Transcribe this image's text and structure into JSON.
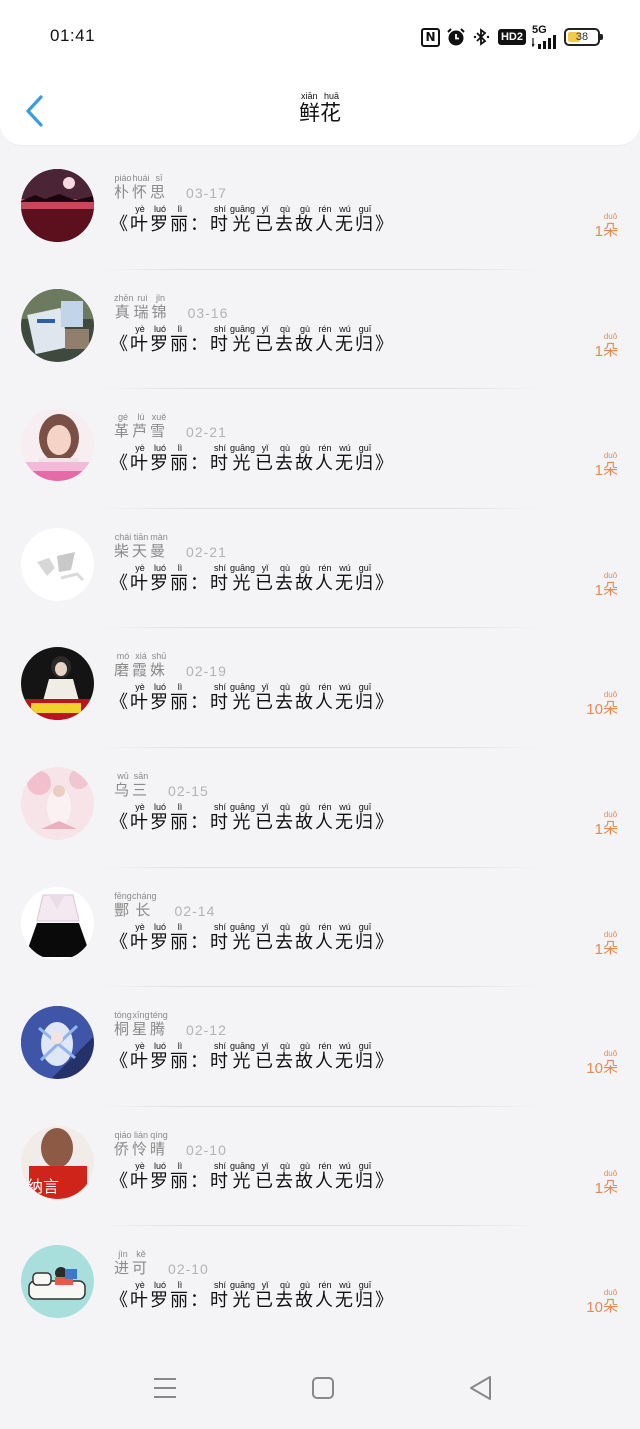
{
  "status": {
    "time": "01:41",
    "battery": "38",
    "network": "5G",
    "hd": "HD2",
    "nfc": "N"
  },
  "header": {
    "title": "鲜花",
    "title_pinyin": "xiān huā"
  },
  "records": [
    {
      "name": "朴怀思",
      "name_pinyin": "piáo huái sī",
      "date": "03-17",
      "work": "《叶罗丽：时光已去故人无归》",
      "count": "1",
      "avatar": "avatar-night-lake"
    },
    {
      "name": "真瑞锦",
      "name_pinyin": "zhēn ruì jǐn",
      "date": "03-16",
      "work": "《叶罗丽：时光已去故人无归》",
      "count": "1",
      "avatar": "avatar-poster-reader"
    },
    {
      "name": "革芦雪",
      "name_pinyin": "gé lú xuě",
      "date": "02-21",
      "work": "《叶罗丽：时光已去故人无归》",
      "count": "1",
      "avatar": "avatar-girl-caption"
    },
    {
      "name": "柴天曼",
      "name_pinyin": "chái tiān màn",
      "date": "02-21",
      "work": "《叶罗丽：时光已去故人无归》",
      "count": "1",
      "avatar": "avatar-blank-sketch"
    },
    {
      "name": "磨霞姝",
      "name_pinyin": "mó xiá shū",
      "date": "02-19",
      "work": "《叶罗丽：时光已去故人无归》",
      "count": "10",
      "avatar": "avatar-dark-girl"
    },
    {
      "name": "乌三",
      "name_pinyin": "wū sān",
      "date": "02-15",
      "work": "《叶罗丽：时光已去故人无归》",
      "count": "1",
      "avatar": "avatar-pink-blossom"
    },
    {
      "name": "酆长",
      "name_pinyin": "fēng cháng",
      "date": "02-14",
      "work": "《叶罗丽：时光已去故人无归》",
      "count": "1",
      "avatar": "avatar-outfit"
    },
    {
      "name": "桐星腾",
      "name_pinyin": "tóng xīng téng",
      "date": "02-12",
      "work": "《叶罗丽：时光已去故人无归》",
      "count": "10",
      "avatar": "avatar-anime-blue"
    },
    {
      "name": "侨怜晴",
      "name_pinyin": "qiáo lián qíng",
      "date": "02-10",
      "work": "《叶罗丽：时光已去故人无归》",
      "count": "1",
      "avatar": "avatar-red-hair"
    },
    {
      "name": "进可",
      "name_pinyin": "jìn kě",
      "date": "02-10",
      "work": "《叶罗丽：时光已去故人无归》",
      "count": "10",
      "avatar": "avatar-sofa-reader"
    }
  ],
  "work_pinyin": [
    "",
    "yè",
    "luó",
    "lì",
    "",
    "shí",
    "guāng",
    "yǐ",
    "qù",
    "gù",
    "rén",
    "wú",
    "guī",
    ""
  ],
  "unit": {
    "text": "朵",
    "pinyin": "duǒ"
  },
  "colors": {
    "accent": "#e38b55",
    "back": "#3a9be0"
  }
}
